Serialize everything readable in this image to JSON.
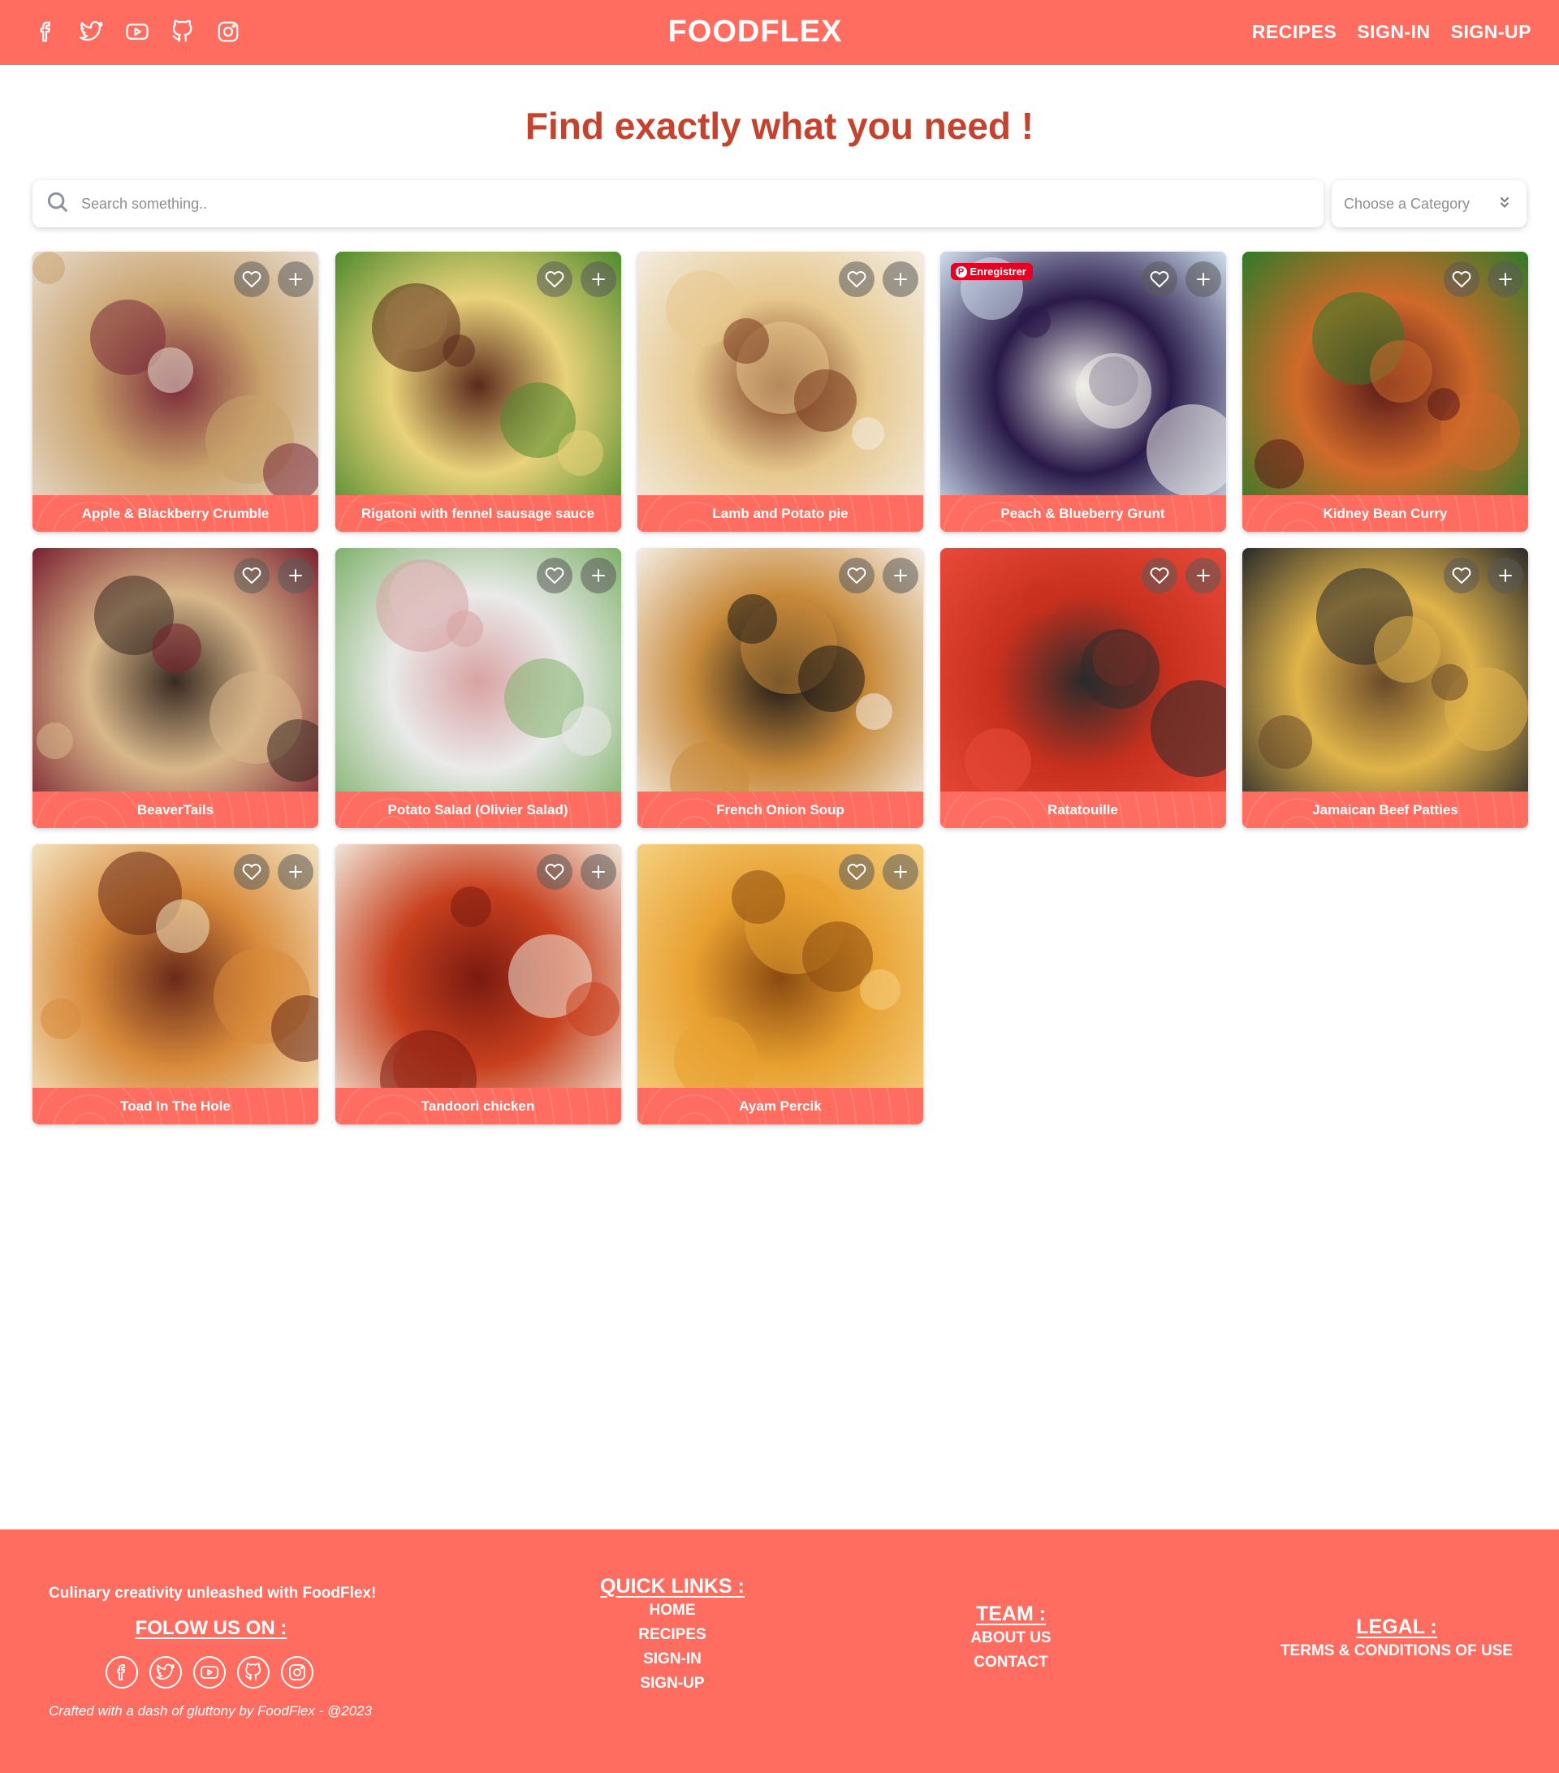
{
  "header": {
    "brand": "FOODFLEX",
    "nav": [
      {
        "label": "RECIPES"
      },
      {
        "label": "SIGN-IN"
      },
      {
        "label": "SIGN-UP"
      }
    ],
    "social_icons": [
      "facebook-icon",
      "twitter-icon",
      "youtube-icon",
      "github-icon",
      "instagram-icon"
    ]
  },
  "hero": {
    "title": "Find exactly what you need !"
  },
  "search": {
    "placeholder": "Search something..",
    "category_placeholder": "Choose a Category"
  },
  "recipes": [
    {
      "name": "Apple & Blackberry Crumble"
    },
    {
      "name": "Rigatoni with fennel sausage sauce"
    },
    {
      "name": "Lamb and Potato pie"
    },
    {
      "name": "Peach & Blueberry Grunt",
      "pin_label": "Enregistrer"
    },
    {
      "name": "Kidney Bean Curry"
    },
    {
      "name": "BeaverTails"
    },
    {
      "name": "Potato Salad (Olivier Salad)"
    },
    {
      "name": "French Onion Soup"
    },
    {
      "name": "Ratatouille"
    },
    {
      "name": "Jamaican Beef Patties"
    },
    {
      "name": "Toad In The Hole"
    },
    {
      "name": "Tandoori chicken"
    },
    {
      "name": "Ayam Percik"
    }
  ],
  "footer": {
    "tagline": "Culinary creativity unleashed with FoodFlex!",
    "follow_title": "FOLOW US ON :",
    "crafted": "Crafted with a dash of gluttony by FoodFlex - @2023",
    "quick_links_title": "QUICK LINKS :",
    "quick_links": [
      "HOME",
      "RECIPES",
      "SIGN-IN",
      "SIGN-UP"
    ],
    "team_title": "TEAM :",
    "team_links": [
      "ABOUT US",
      "CONTACT"
    ],
    "legal_title": "LEGAL :",
    "legal_links": [
      "TERMS & CONDITIONS OF USE"
    ]
  },
  "colors": {
    "brand": "#ff6d60",
    "title": "#c4432f"
  }
}
